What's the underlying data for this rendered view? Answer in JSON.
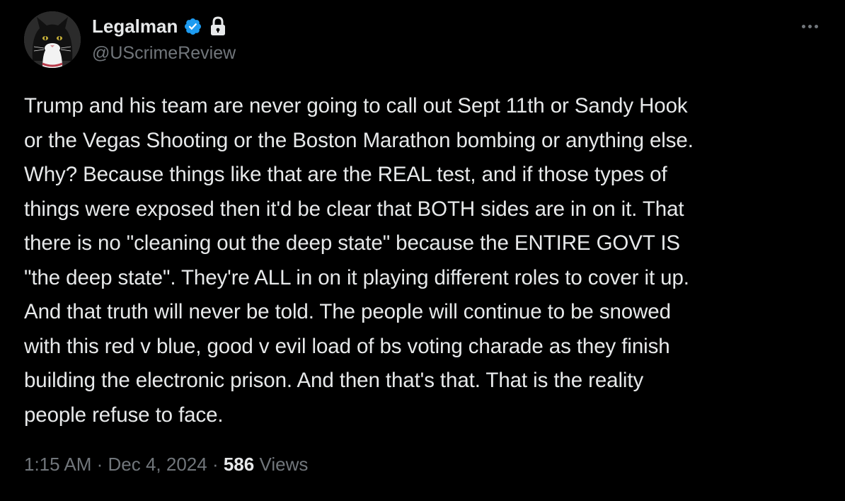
{
  "author": {
    "display_name": "Legalman",
    "handle": "@UScrimeReview",
    "verified": true,
    "protected": true,
    "avatar": "tuxedo-cat-avatar"
  },
  "tweet": {
    "text": "Trump and his team are never going to call out Sept 11th or Sandy Hook\nor the Vegas Shooting or the Boston Marathon bombing or anything else.\nWhy? Because things like that are the REAL test, and if those types of\nthings were exposed then it'd be clear that BOTH sides are in on it. That\nthere is no \"cleaning out the deep state\" because the ENTIRE GOVT IS\n\"the deep state\". They're ALL in on it playing different roles to cover it up.\nAnd that truth will never be told. The people will continue to be snowed\nwith this red v blue, good v evil load of bs voting charade as they finish\nbuilding the electronic prison. And then that's that. That is the reality\npeople refuse to face."
  },
  "meta": {
    "time": "1:15 AM",
    "separator": " · ",
    "date": "Dec 4, 2024",
    "views_count": "586",
    "views_label": " Views"
  },
  "icons": {
    "verified": "verified-badge-icon",
    "lock": "lock-icon",
    "more": "more-options-icon"
  },
  "colors": {
    "background": "#000000",
    "text_primary": "#e7e9ea",
    "text_secondary": "#71767b",
    "verified_blue": "#1d9bf0"
  }
}
